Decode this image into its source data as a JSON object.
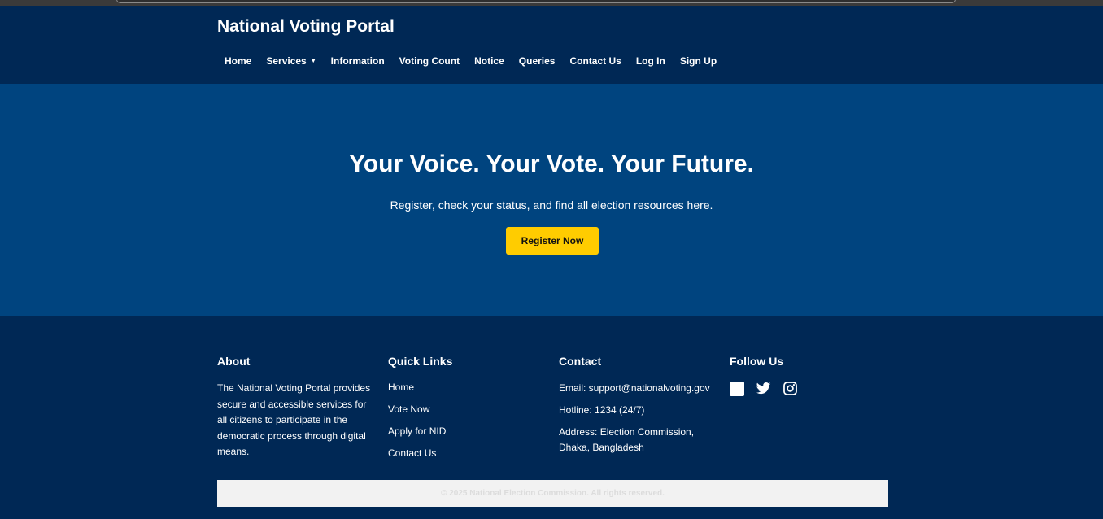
{
  "header": {
    "title": "National Voting Portal",
    "nav": [
      {
        "label": "Home"
      },
      {
        "label": "Services",
        "has_dropdown": true
      },
      {
        "label": "Information"
      },
      {
        "label": "Voting Count"
      },
      {
        "label": "Notice"
      },
      {
        "label": "Queries"
      },
      {
        "label": "Contact Us"
      },
      {
        "label": "Log In"
      },
      {
        "label": "Sign Up"
      }
    ]
  },
  "hero": {
    "headline": "Your Voice. Your Vote. Your Future.",
    "subtext": "Register, check your status, and find all election resources here.",
    "cta_label": "Register Now"
  },
  "footer": {
    "about": {
      "heading": "About",
      "text": "The National Voting Portal provides secure and accessible services for all citizens to participate in the democratic process through digital means."
    },
    "quick_links": {
      "heading": "Quick Links",
      "items": [
        "Home",
        "Vote Now",
        "Apply for NID",
        "Contact Us"
      ]
    },
    "contact": {
      "heading": "Contact",
      "email": "Email: support@nationalvoting.gov",
      "hotline": "Hotline: 1234 (24/7)",
      "address": "Address: Election Commission, Dhaka, Bangladesh"
    },
    "follow": {
      "heading": "Follow Us",
      "icons": [
        "facebook-icon",
        "twitter-icon",
        "instagram-icon"
      ]
    },
    "copyright": "© 2025 National Election Commission. All rights reserved."
  },
  "colors": {
    "header_bg": "#002855",
    "hero_bg": "#00447f",
    "cta_bg": "#ffcc00",
    "copyright_bg": "#f2f2f2"
  }
}
